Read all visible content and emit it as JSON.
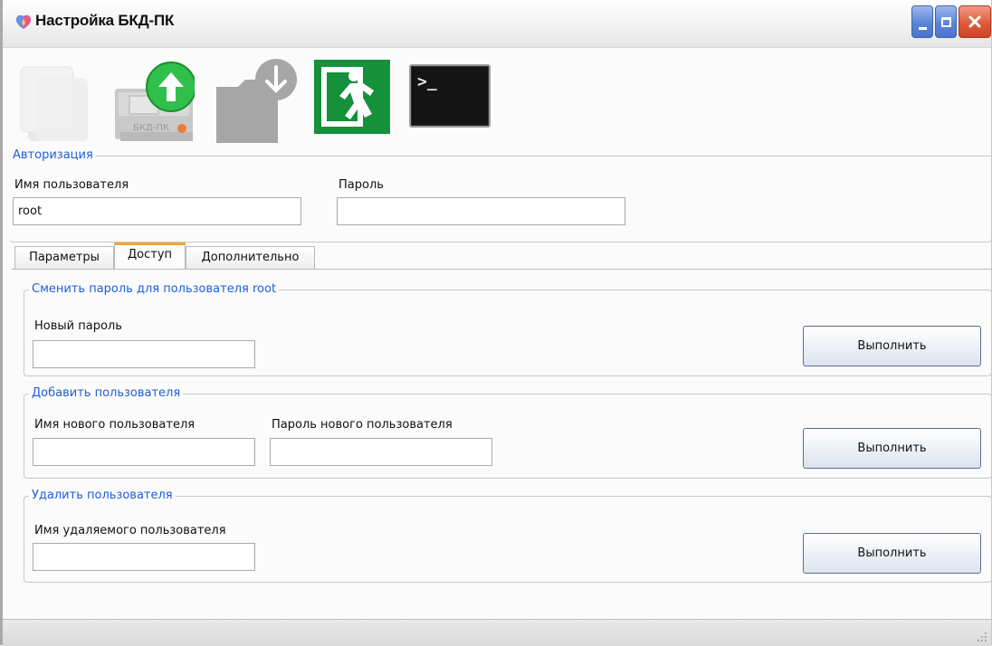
{
  "window": {
    "title": "Настройка БКД-ПК"
  },
  "toolbar": {
    "items": [
      {
        "name": "new-document",
        "icon": "document-stack-icon"
      },
      {
        "name": "upload",
        "icon": "upload-device-icon",
        "caption": "БКД-ПК"
      },
      {
        "name": "download",
        "icon": "download-folder-icon"
      },
      {
        "name": "exit",
        "icon": "exit-running-man-icon"
      },
      {
        "name": "terminal",
        "icon": "terminal-icon",
        "glyph": ">_"
      }
    ]
  },
  "auth": {
    "title": "Авторизация",
    "username_label": "Имя пользователя",
    "username_value": "root",
    "password_label": "Пароль",
    "password_value": ""
  },
  "tabs": [
    {
      "label": "Параметры",
      "active": false
    },
    {
      "label": "Доступ",
      "active": true
    },
    {
      "label": "Дополнительно",
      "active": false
    }
  ],
  "access": {
    "change_password": {
      "title": "Сменить пароль для пользователя root",
      "new_password_label": "Новый пароль",
      "new_password_value": "",
      "button": "Выполнить"
    },
    "add_user": {
      "title": "Добавить пользователя",
      "name_label": "Имя нового пользователя",
      "name_value": "",
      "password_label": "Пароль нового пользователя",
      "password_value": "",
      "button": "Выполнить"
    },
    "delete_user": {
      "title": "Удалить пользователя",
      "name_label": "Имя удаляемого пользователя",
      "name_value": "",
      "button": "Выполнить"
    }
  },
  "colors": {
    "group_title": "#1f5fd6",
    "active_tab_accent": "#f0a830",
    "upload_green": "#2fbf4a",
    "exit_green": "#14913a"
  }
}
